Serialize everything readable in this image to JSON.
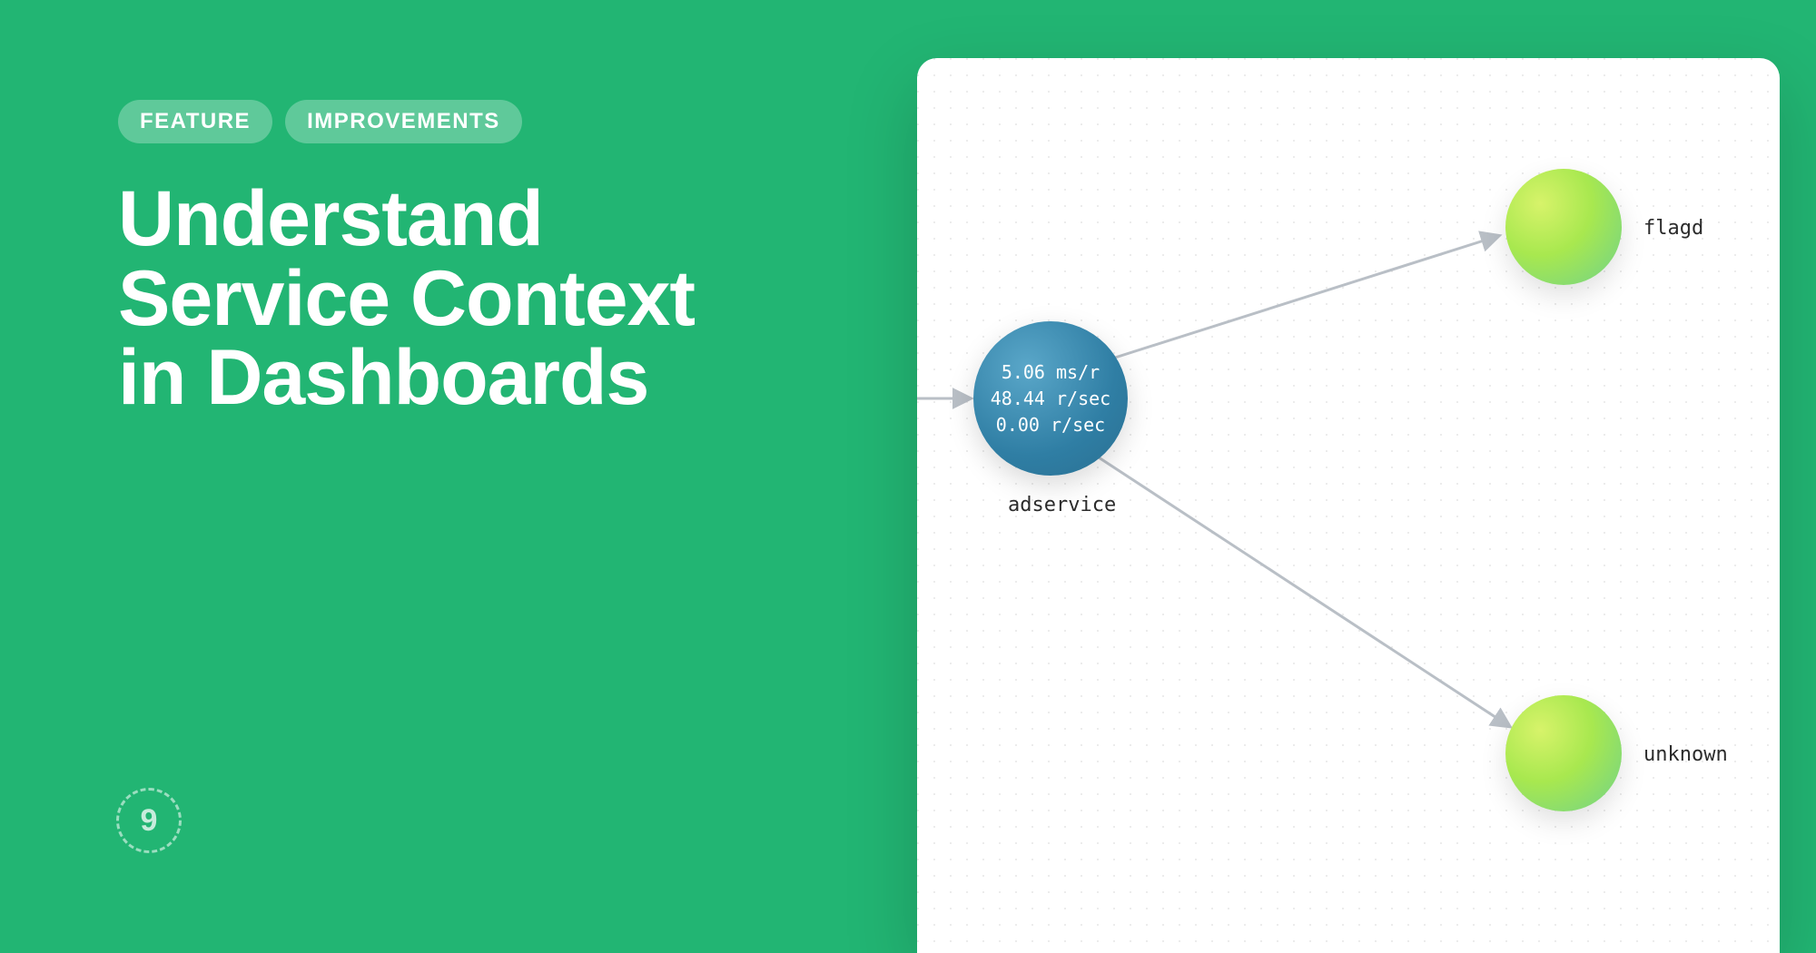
{
  "badges": [
    "FEATURE",
    "IMPROVEMENTS"
  ],
  "headline_lines": [
    "Understand",
    "Service Context",
    "in Dashboards"
  ],
  "logo_text": "9",
  "graph": {
    "main_node": {
      "name": "adservice",
      "metrics": [
        "5.06 ms/r",
        "48.44 r/sec",
        "0.00 r/sec"
      ]
    },
    "targets": [
      {
        "name": "flagd"
      },
      {
        "name": "unknown"
      }
    ]
  }
}
